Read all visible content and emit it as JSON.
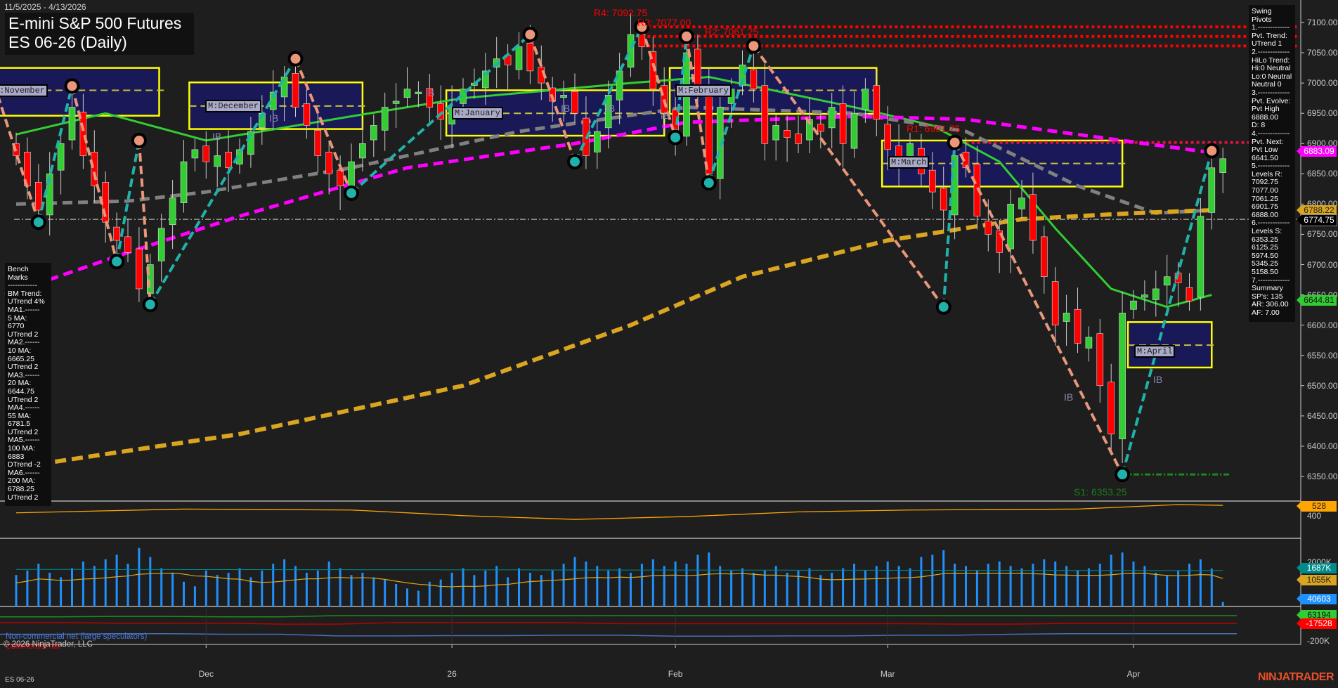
{
  "header": {
    "date_range": "11/5/2025 - 4/13/2026",
    "title": "E-mini S&P 500 Futures",
    "subtitle": "ES 06-26 (Daily)"
  },
  "benchmarks": {
    "lines": [
      "Bench Marks",
      "------------",
      "BM Trend:",
      "UTrend 4%",
      "MA1.------",
      "5 MA:",
      "6770",
      "UTrend 2",
      "MA2.------",
      "10 MA:",
      "6665.25",
      "UTrend 2",
      "MA3.------",
      "20 MA:",
      "6644.75",
      "UTrend 2",
      "MA4.------",
      "55 MA:",
      "6781.5",
      "UTrend 2",
      "MA5.------",
      "100 MA:",
      "6883",
      "DTrend -2",
      "MA6.------",
      "200 MA:",
      "6788.25",
      "UTrend 2"
    ]
  },
  "swing_pivots": {
    "lines": [
      "Swing Pivots",
      "1.-------------",
      "Pvt. Trend:",
      "UTrend 1",
      "2.-------------",
      "HiLo Trend:",
      "Hi:0 Neutral",
      "Lo:0 Neutral",
      "Neutral 0",
      "3.-------------",
      "Pvt. Evolve:",
      "Pvt High",
      "6888.00",
      "D: 8",
      "4.-------------",
      "Pvt. Next:",
      "Pvt Low",
      "6641.50",
      "5.-------------",
      "Levels R:",
      "7092.75",
      "7077.00",
      "7061.25",
      "6901.75",
      "6888.00",
      "6.-------------",
      "Levels S:",
      "6353.25",
      "6125.25",
      "5974.50",
      "5345.25",
      "5158.50",
      "7.-------------",
      "Summary",
      "SP's: 135",
      "AR: 306.00",
      "AF: 7.00"
    ]
  },
  "level_labels": {
    "r4": "R4: 7092.75",
    "r3": "R3: 7077.00",
    "r2": "R2: 7061.25",
    "r1": "R1: 6901.75",
    "s1": "S1: 6353.25"
  },
  "month_labels": [
    "M:November",
    "M:December",
    "M:January",
    "M:February",
    "M:March",
    "M:April"
  ],
  "ib_label": "IB",
  "price_tags": {
    "ma100": "6883.09",
    "ma200": "6788.22",
    "last": "6774.75",
    "ma20": "6644.81"
  },
  "indicator_tags": {
    "osc": "528",
    "vol": "1687K",
    "vol_avg": "1055K",
    "cot_spec": "40603",
    "cot_green": "63194",
    "cot_red": "-17528"
  },
  "indicator_ticks": {
    "osc": "400",
    "vol": "2000K",
    "cot": "-200K"
  },
  "legend": {
    "noncommercial": "Non-commercial net (large speculators)",
    "commercial": "Commercial net",
    "copyright": "© 2026 NinjaTrader, LLC"
  },
  "footer": {
    "instrument": "ES 06-26",
    "logo": "NINJATRADER"
  },
  "colors": {
    "up": "#32cd32",
    "down": "#ff0000",
    "ma20": "#32cd32",
    "ma55": "#808080",
    "ma100": "#ff00ff",
    "ma200": "#daa520",
    "zone": "#191957",
    "zone_border": "#ffff00"
  },
  "chart_data": {
    "type": "candlestick",
    "title": "E-mini S&P 500 Futures ES 06-26 (Daily)",
    "x_ticks": [
      "Dec",
      "26",
      "Feb",
      "Mar",
      "Apr"
    ],
    "x_tick_bar_index": [
      17,
      39,
      59,
      78,
      100
    ],
    "y_ticks": [
      "7100.00",
      "7050.00",
      "7000.00",
      "6950.00",
      "6900.00",
      "6850.00",
      "6800.00",
      "6750.00",
      "6700.00",
      "6650.00",
      "6600.00",
      "6550.00",
      "6500.00",
      "6450.00",
      "6400.00",
      "6350.00"
    ],
    "ylim": [
      6315,
      7125
    ],
    "close": [
      6880,
      6830,
      6790,
      6850,
      6900,
      6960,
      6880,
      6830,
      6770,
      6740,
      6720,
      6660,
      6700,
      6760,
      6810,
      6870,
      6890,
      6870,
      6880,
      6860,
      6890,
      6920,
      6950,
      6985,
      7010,
      6960,
      6930,
      6880,
      6850,
      6830,
      6870,
      6900,
      6930,
      6960,
      6970,
      6990,
      6985,
      6960,
      6940,
      6960,
      6990,
      7000,
      7020,
      7040,
      7030,
      7060,
      7020,
      7000,
      6970,
      6980,
      6950,
      6880,
      6920,
      6980,
      7020,
      7080,
      7060,
      6990,
      6950,
      6920,
      7050,
      6990,
      6850,
      6960,
      6990,
      7030,
      6990,
      6900,
      6930,
      6910,
      6900,
      6940,
      6920,
      6960,
      6900,
      6950,
      6990,
      6940,
      6890,
      6870,
      6900,
      6850,
      6820,
      6790,
      6880,
      6860,
      6780,
      6750,
      6720,
      6800,
      6810,
      6740,
      6680,
      6600,
      6620,
      6570,
      6580,
      6500,
      6420,
      6620,
      6640,
      6650,
      6660,
      6680,
      6670,
      6640,
      6780,
      6860,
      6875
    ],
    "volume_k": [
      1400,
      1600,
      1900,
      1500,
      1300,
      1700,
      2000,
      1800,
      2100,
      2300,
      1900,
      2600,
      2200,
      1700,
      1500,
      1100,
      900,
      1600,
      1400,
      1500,
      1700,
      1300,
      1600,
      1900,
      2100,
      1800,
      1500,
      1600,
      2000,
      1700,
      1400,
      1500,
      1300,
      1200,
      1000,
      800,
      700,
      1100,
      1200,
      1500,
      1700,
      1400,
      1600,
      1800,
      1300,
      1700,
      1500,
      1400,
      1600,
      1900,
      2200,
      2000,
      1800,
      1600,
      1700,
      1500,
      1900,
      2100,
      1800,
      2000,
      1900,
      2300,
      2400,
      1800,
      1600,
      1700,
      1500,
      1600,
      1800,
      1500,
      1600,
      1700,
      1400,
      1500,
      1700,
      1900,
      1600,
      1800,
      2000,
      1800,
      1700,
      2200,
      2300,
      2500,
      1900,
      1800,
      1600,
      1900,
      2000,
      1800,
      1700,
      1900,
      2100,
      2000,
      1800,
      1600,
      1700,
      1900,
      2300,
      2400,
      2000,
      1800,
      1500,
      1400,
      1600,
      1900,
      2100,
      1687,
      200
    ],
    "ma_series": [
      {
        "name": "20 MA",
        "points": [
          [
            0,
            6915
          ],
          [
            8,
            6950
          ],
          [
            17,
            6905
          ],
          [
            30,
            6945
          ],
          [
            40,
            6975
          ],
          [
            55,
            7000
          ],
          [
            62,
            7010
          ],
          [
            75,
            6960
          ],
          [
            82,
            6930
          ],
          [
            88,
            6870
          ],
          [
            93,
            6760
          ],
          [
            98,
            6660
          ],
          [
            103,
            6630
          ],
          [
            107,
            6650
          ]
        ]
      },
      {
        "name": "55 MA",
        "points": [
          [
            0,
            6800
          ],
          [
            10,
            6805
          ],
          [
            17,
            6820
          ],
          [
            30,
            6860
          ],
          [
            45,
            6920
          ],
          [
            60,
            6960
          ],
          [
            75,
            6950
          ],
          [
            85,
            6920
          ],
          [
            95,
            6830
          ],
          [
            102,
            6785
          ],
          [
            107,
            6790
          ]
        ]
      },
      {
        "name": "100 MA",
        "points": [
          [
            -1,
            6650
          ],
          [
            10,
            6720
          ],
          [
            20,
            6780
          ],
          [
            35,
            6860
          ],
          [
            50,
            6900
          ],
          [
            60,
            6935
          ],
          [
            75,
            6945
          ],
          [
            85,
            6940
          ],
          [
            95,
            6915
          ],
          [
            107,
            6885
          ]
        ]
      },
      {
        "name": "200 MA",
        "points": [
          [
            -1,
            6362
          ],
          [
            20,
            6420
          ],
          [
            40,
            6500
          ],
          [
            55,
            6600
          ],
          [
            65,
            6680
          ],
          [
            78,
            6740
          ],
          [
            90,
            6775
          ],
          [
            100,
            6785
          ],
          [
            107,
            6790
          ]
        ]
      }
    ],
    "swing_pivots": [
      [
        -2,
        7000
      ],
      [
        2,
        6770
      ],
      [
        5,
        6995
      ],
      [
        9,
        6705
      ],
      [
        11,
        6905
      ],
      [
        12,
        6634
      ],
      [
        25,
        7040
      ],
      [
        30,
        6818
      ],
      [
        46,
        7080
      ],
      [
        50,
        6870
      ],
      [
        56,
        7092.75
      ],
      [
        59,
        6910
      ],
      [
        60,
        7077
      ],
      [
        62,
        6835
      ],
      [
        66,
        7061.25
      ],
      [
        83,
        6630
      ],
      [
        84,
        6901.75
      ],
      [
        99,
        6353.25
      ],
      [
        107,
        6888
      ]
    ],
    "month_value_areas": [
      {
        "label": "M:November",
        "start": -2,
        "end": 12.8,
        "high": 7025,
        "low": 6946,
        "mid": 6988
      },
      {
        "label": "M:December",
        "start": 16,
        "end": 31,
        "high": 7001,
        "low": 6924,
        "mid": 6962
      },
      {
        "label": "M:January",
        "start": 39,
        "end": 58,
        "high": 6988,
        "low": 6913,
        "mid": 6950
      },
      {
        "label": "M:February",
        "start": 59,
        "end": 77,
        "high": 7025,
        "low": 6949,
        "mid": 6988
      },
      {
        "label": "M:March",
        "start": 78,
        "end": 99,
        "high": 6905,
        "low": 6829,
        "mid": 6867
      },
      {
        "label": "M:April",
        "start": 100,
        "end": 107,
        "high": 6605,
        "low": 6530,
        "mid": 6567
      }
    ],
    "resistance": [
      7092.75,
      7077.0,
      7061.25,
      6901.75
    ],
    "support": [
      6353.25
    ],
    "last_line": 6774.75,
    "oscillator": {
      "ylabel_tick": 400,
      "points": [
        [
          0,
          440
        ],
        [
          15,
          480
        ],
        [
          30,
          470
        ],
        [
          40,
          410
        ],
        [
          50,
          370
        ],
        [
          60,
          400
        ],
        [
          70,
          450
        ],
        [
          80,
          470
        ],
        [
          95,
          480
        ],
        [
          104,
          528
        ],
        [
          108,
          520
        ]
      ]
    },
    "cot": {
      "green": [
        50000,
        50000,
        55000,
        55000,
        50000,
        50000,
        63000,
        63000,
        63000,
        63000,
        63000,
        63000,
        63000,
        63000,
        63000,
        63000,
        63000,
        63000,
        63000,
        63000,
        63000,
        63194,
        63194
      ],
      "red": [
        -10000,
        -10000,
        -15000,
        -15000,
        -15000,
        -25000,
        -25000,
        -10000,
        -10000,
        -10000,
        -10000,
        -20000,
        -20000,
        -20000,
        -20000,
        -20000,
        -20000,
        -25000,
        -25000,
        -17528,
        -17528,
        -17528,
        -17528
      ],
      "blue": [
        -130000,
        -130000,
        -125000,
        -125000,
        -130000,
        -130000,
        -148000,
        -148000,
        -145000,
        -145000,
        -140000,
        -140000,
        -150000,
        -150000,
        -148000,
        -148000,
        -140000,
        -140000,
        -130000,
        -125000,
        -125000,
        -125000,
        -125000
      ]
    }
  }
}
